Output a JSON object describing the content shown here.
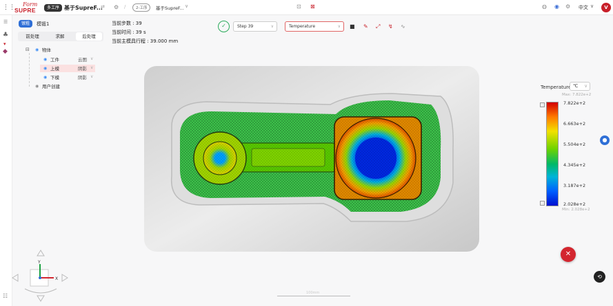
{
  "header": {
    "brand_top": "Form",
    "brand_bottom": "SUPRE",
    "mode_tag": "多工序",
    "project_name": "基于SupreF...",
    "breadcrumb_tag": "2-工序",
    "breadcrumb_name": "基于SupreF...",
    "language": "中文",
    "avatar_letter": "V"
  },
  "panel": {
    "group_tag": "镦粗",
    "model_name": "模锻1",
    "tabs": [
      "前处理",
      "求解",
      "后处理"
    ],
    "active_tab": 2,
    "tree": {
      "root": "物体",
      "items": [
        {
          "name": "工件",
          "mode": "云图"
        },
        {
          "name": "上模",
          "mode": "阴影"
        },
        {
          "name": "下模",
          "mode": "阴影"
        }
      ],
      "user_created": "用户创建"
    }
  },
  "info": {
    "step": "当前步数 : 39",
    "time": "当前时间 : 39 s",
    "stroke": "当前主模具行程 : 39.000 mm"
  },
  "toolbar": {
    "step_select": "Step 39",
    "variable_select": "Temperature"
  },
  "legend": {
    "title": "Temperature",
    "unit": "℃",
    "max_label": "Max: 7.822e+2",
    "min_label": "Min: 2.028e+2",
    "ticks": [
      "7.822e+2",
      "6.663e+2",
      "5.504e+2",
      "4.345e+2",
      "3.187e+2",
      "2.028e+2"
    ],
    "colors": [
      "#d20000",
      "#ff7a00",
      "#f2e100",
      "#6fd300",
      "#00b86a",
      "#00b4d8",
      "#0060ff",
      "#0010d0"
    ]
  },
  "axis": {
    "y": "Y",
    "x": "X"
  },
  "scale_bar": "100mm"
}
